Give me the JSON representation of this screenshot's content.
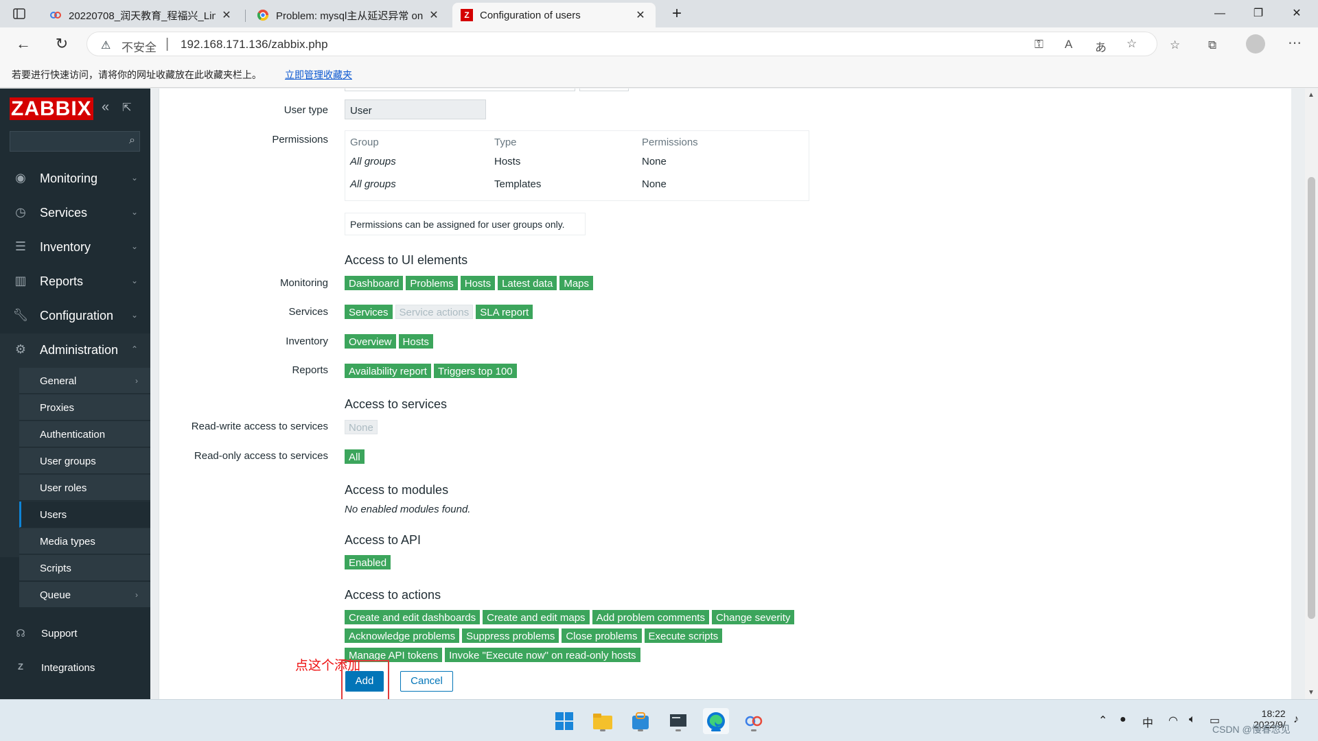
{
  "browser": {
    "tabs": [
      {
        "label": "20220708_润天教育_程福兴_Linu",
        "icon": "baidu-cloud-icon"
      },
      {
        "label": "Problem: mysql主从延迟异常 on",
        "icon": "chrome-icon"
      },
      {
        "label": "Configuration of users",
        "icon": "zabbix-icon",
        "favicon_letter": "Z"
      }
    ],
    "new_tab": "+",
    "insecure_label": "不安全",
    "url": "192.168.171.136/zabbix.php",
    "bookmark_message": "若要进行快速访问，请将你的网址收藏放在此收藏夹栏上。",
    "bookmark_manage": "立即管理收藏夹"
  },
  "sidebar": {
    "logo": "ZABBIX",
    "collapse_glyph": "«",
    "menu": [
      {
        "label": "Monitoring",
        "icon": "eye-icon"
      },
      {
        "label": "Services",
        "icon": "clock-icon"
      },
      {
        "label": "Inventory",
        "icon": "list-icon"
      },
      {
        "label": "Reports",
        "icon": "bar-chart-icon"
      },
      {
        "label": "Configuration",
        "icon": "wrench-icon"
      },
      {
        "label": "Administration",
        "icon": "gear-icon"
      }
    ],
    "admin_submenu": [
      "General",
      "Proxies",
      "Authentication",
      "User groups",
      "User roles",
      "Users",
      "Media types",
      "Scripts",
      "Queue"
    ],
    "bottom": [
      {
        "label": "Support",
        "icon": "headset-icon"
      },
      {
        "label": "Integrations",
        "icon": "zabbix-z-icon"
      }
    ]
  },
  "form": {
    "user_type_label": "User type",
    "user_type_value": "User",
    "permissions_label": "Permissions",
    "perm_headers": [
      "Group",
      "Type",
      "Permissions"
    ],
    "perm_rows": [
      {
        "group": "All groups",
        "type": "Hosts",
        "perm": "None"
      },
      {
        "group": "All groups",
        "type": "Templates",
        "perm": "None"
      }
    ],
    "perm_note": "Permissions can be assigned for user groups only.",
    "ui_heading": "Access to UI elements",
    "ui_rows": [
      {
        "label": "Monitoring",
        "tags": [
          {
            "t": "Dashboard",
            "on": true
          },
          {
            "t": "Problems",
            "on": true
          },
          {
            "t": "Hosts",
            "on": true
          },
          {
            "t": "Latest data",
            "on": true
          },
          {
            "t": "Maps",
            "on": true
          }
        ]
      },
      {
        "label": "Services",
        "tags": [
          {
            "t": "Services",
            "on": true
          },
          {
            "t": "Service actions",
            "on": false
          },
          {
            "t": "SLA report",
            "on": true
          }
        ]
      },
      {
        "label": "Inventory",
        "tags": [
          {
            "t": "Overview",
            "on": true
          },
          {
            "t": "Hosts",
            "on": true
          }
        ]
      },
      {
        "label": "Reports",
        "tags": [
          {
            "t": "Availability report",
            "on": true
          },
          {
            "t": "Triggers top 100",
            "on": true
          }
        ]
      }
    ],
    "services_heading": "Access to services",
    "rw_label": "Read-write access to services",
    "rw_value": "None",
    "ro_label": "Read-only access to services",
    "ro_value": "All",
    "modules_heading": "Access to modules",
    "modules_note": "No enabled modules found.",
    "api_heading": "Access to API",
    "api_value": "Enabled",
    "actions_heading": "Access to actions",
    "action_rows": [
      [
        "Create and edit dashboards",
        "Create and edit maps",
        "Add problem comments",
        "Change severity"
      ],
      [
        "Acknowledge problems",
        "Suppress problems",
        "Close problems",
        "Execute scripts"
      ],
      [
        "Manage API tokens",
        "Invoke \"Execute now\" on read-only hosts"
      ]
    ],
    "add_label": "Add",
    "cancel_label": "Cancel",
    "annotation": "点这个添加"
  },
  "taskbar": {
    "apps": [
      "windows-start-icon",
      "file-explorer-icon",
      "store-icon",
      "terminal-icon",
      "edge-icon",
      "baidu-cloud-icon"
    ],
    "ime": "中",
    "time": "18:22",
    "date": "2022/9/",
    "watermark": "CSDN @慢春忽见"
  },
  "colors": {
    "sidebar_bg": "#1f2c33",
    "tag_green": "#3ca55c",
    "primary_blue": "#0275b8",
    "logo_red": "#d40000"
  }
}
